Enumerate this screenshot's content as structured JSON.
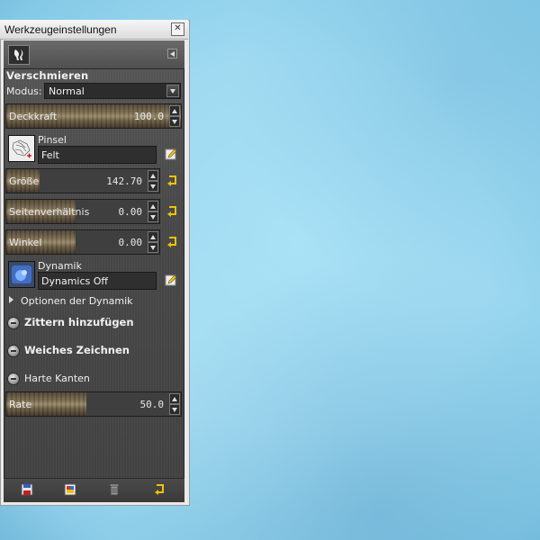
{
  "window": {
    "title": "Werkzeugeinstellungen",
    "close_glyph": "✕"
  },
  "tool": {
    "name": "Verschmieren",
    "icon": "smudge-tool-icon"
  },
  "mode": {
    "label": "Modus:",
    "value": "Normal"
  },
  "opacity": {
    "label": "Deckkraft",
    "value": "100.0",
    "fill_fraction": 1.0
  },
  "brush": {
    "label": "Pinsel",
    "value": "Felt"
  },
  "size": {
    "label": "Größe",
    "value": "142.70",
    "fill_fraction": 0.22
  },
  "aspect": {
    "label": "Seitenverhältnis",
    "value": "0.00",
    "fill_fraction": 0.5
  },
  "angle": {
    "label": "Winkel",
    "value": "0.00",
    "fill_fraction": 0.5
  },
  "dynamics": {
    "label": "Dynamik",
    "value": "Dynamics Off",
    "options_label": "Optionen der Dynamik"
  },
  "options": {
    "jitter": "Zittern hinzufügen",
    "smooth": "Weiches Zeichnen",
    "hard_edges": "Harte Kanten"
  },
  "rate": {
    "label": "Rate",
    "value": "50.0",
    "fill_fraction": 0.5
  },
  "bottom_buttons": [
    "save-preset-icon",
    "restore-preset-icon",
    "delete-preset-icon",
    "reset-icon"
  ],
  "colors": {
    "panel": "#4a4a4a",
    "accent_reset": "#f2c200",
    "canvas": "#a9e1f6"
  }
}
